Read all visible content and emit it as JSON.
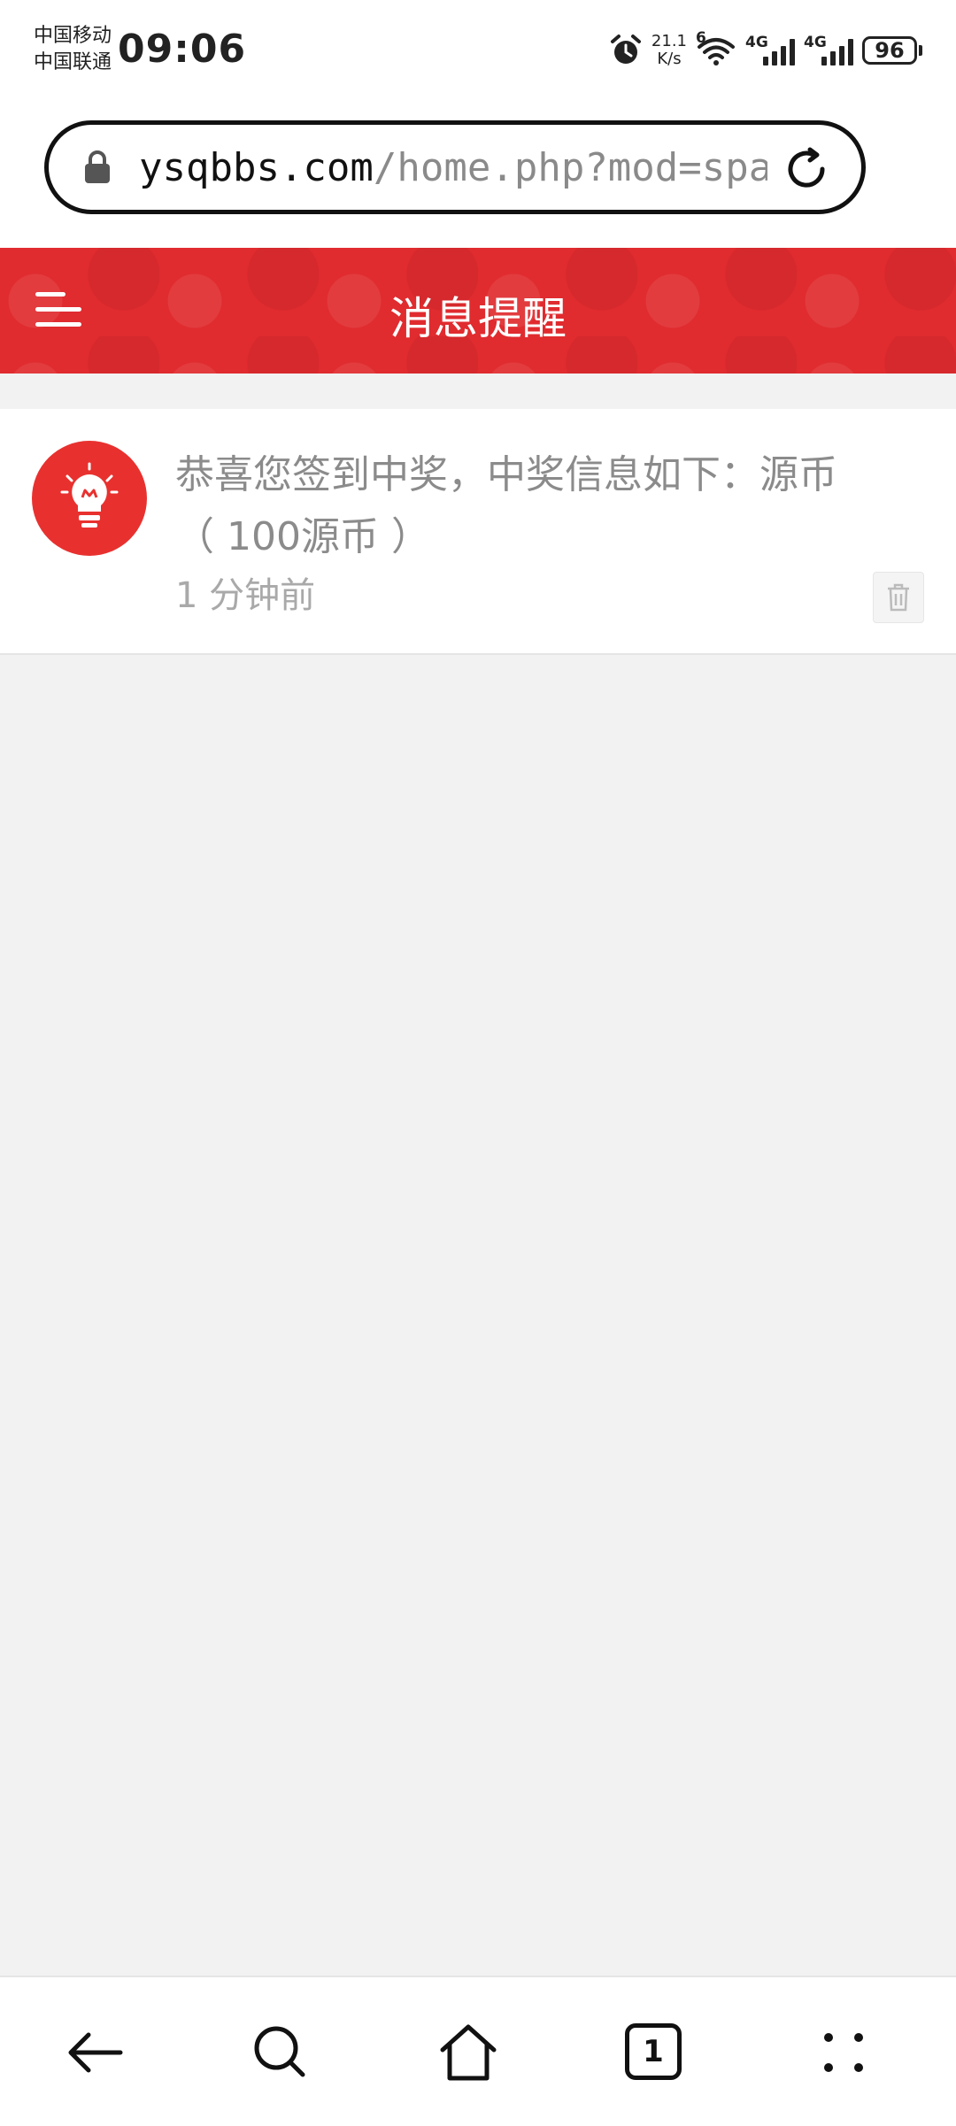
{
  "status_bar": {
    "carrier_1": "中国移动",
    "carrier_2": "中国联通",
    "time": "09:06",
    "net_speed_value": "21.1",
    "net_speed_unit": "K/s",
    "wifi_label": "6",
    "sim1_label": "4G",
    "sim2_label": "4G",
    "battery": "96"
  },
  "browser": {
    "url_host": "ysqbbs.com",
    "url_path": "/home.php?mod=space&d"
  },
  "header": {
    "title": "消息提醒"
  },
  "notifications": [
    {
      "text": "恭喜您签到中奖，中奖信息如下：源币（ 100源币 ）",
      "time": "1 分钟前"
    }
  ],
  "colors": {
    "brand_red": "#e02b2f",
    "avatar_red": "#e8312f",
    "page_bg": "#f2f2f2"
  },
  "icons": [
    "lock-icon",
    "reload-icon",
    "menu-icon",
    "lightbulb-icon",
    "trash-icon",
    "back-arrow-icon",
    "search-icon",
    "home-icon",
    "tabs-icon",
    "more-icon"
  ]
}
